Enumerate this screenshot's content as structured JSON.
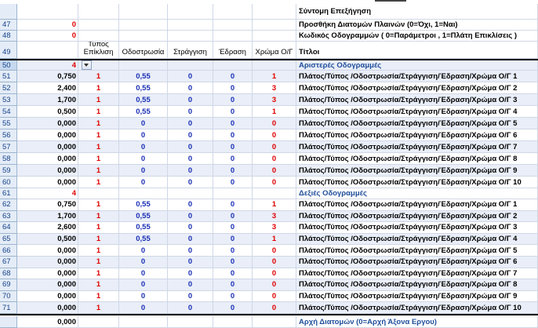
{
  "top_rows": [
    {
      "num": "",
      "b": "",
      "h": "Σύντομη Επεξήγηση"
    },
    {
      "num": "47",
      "b": "0",
      "h": "Προσθήκη Διατομών Πλαινών (0=Όχι, 1=Ναι)"
    },
    {
      "num": "48",
      "b": "0",
      "h": "Κωδικός Οδογραμμών ( 0=Παράμετροι , 1=Πλάτη Επικλίσεις )"
    }
  ],
  "header_row": {
    "num": "49",
    "c": "Τύπος Επίκλιση",
    "d": "Οδοστρωσία",
    "e": "Στράγγιση",
    "f": "Έδραση",
    "g": "Χρώμα Ο/Γ",
    "h": "Τίτλοι"
  },
  "left_group": {
    "num": "50",
    "count": "4",
    "title": "Αριστερές Οδογραμμές"
  },
  "left_rows": [
    {
      "num": "51",
      "b": "0,750",
      "c": "1",
      "d": "0,55",
      "e": "0",
      "f": "0",
      "g": "1",
      "h": "Πλάτος/Τύπος /Οδοστρωσία/Στράγγιση/Έδραση/Χρώμα Ο/Γ 1"
    },
    {
      "num": "52",
      "b": "2,400",
      "c": "1",
      "d": "0,55",
      "e": "0",
      "f": "0",
      "g": "3",
      "h": "Πλάτος/Τύπος /Οδοστρωσία/Στράγγιση/Έδραση/Χρώμα Ο/Γ 2"
    },
    {
      "num": "53",
      "b": "1,700",
      "c": "1",
      "d": "0,55",
      "e": "0",
      "f": "0",
      "g": "3",
      "h": "Πλάτος/Τύπος /Οδοστρωσία/Στράγγιση/Έδραση/Χρώμα Ο/Γ 3"
    },
    {
      "num": "54",
      "b": "0,500",
      "c": "1",
      "d": "0,55",
      "e": "0",
      "f": "0",
      "g": "1",
      "h": "Πλάτος/Τύπος /Οδοστρωσία/Στράγγιση/Έδραση/Χρώμα Ο/Γ 4"
    },
    {
      "num": "55",
      "b": "0,000",
      "c": "1",
      "d": "0",
      "e": "0",
      "f": "0",
      "g": "0",
      "h": "Πλάτος/Τύπος /Οδοστρωσία/Στράγγιση/Έδραση/Χρώμα Ο/Γ 5"
    },
    {
      "num": "56",
      "b": "0,000",
      "c": "1",
      "d": "0",
      "e": "0",
      "f": "0",
      "g": "0",
      "h": "Πλάτος/Τύπος /Οδοστρωσία/Στράγγιση/Έδραση/Χρώμα Ο/Γ 6"
    },
    {
      "num": "57",
      "b": "0,000",
      "c": "1",
      "d": "0",
      "e": "0",
      "f": "0",
      "g": "0",
      "h": "Πλάτος/Τύπος /Οδοστρωσία/Στράγγιση/Έδραση/Χρώμα Ο/Γ 7"
    },
    {
      "num": "58",
      "b": "0,000",
      "c": "1",
      "d": "0",
      "e": "0",
      "f": "0",
      "g": "0",
      "h": "Πλάτος/Τύπος /Οδοστρωσία/Στράγγιση/Έδραση/Χρώμα Ο/Γ 8"
    },
    {
      "num": "59",
      "b": "0,000",
      "c": "1",
      "d": "0",
      "e": "0",
      "f": "0",
      "g": "0",
      "h": "Πλάτος/Τύπος /Οδοστρωσία/Στράγγιση/Έδραση/Χρώμα Ο/Γ 9"
    },
    {
      "num": "60",
      "b": "0,000",
      "c": "1",
      "d": "0",
      "e": "0",
      "f": "0",
      "g": "0",
      "h": "Πλάτος/Τύπος /Οδοστρωσία/Στράγγιση/Έδραση/Χρώμα Ο/Γ 10"
    }
  ],
  "right_group": {
    "num": "61",
    "count": "4",
    "title": "Δεξιές Οδογραμμές"
  },
  "right_rows": [
    {
      "num": "62",
      "b": "0,750",
      "c": "1",
      "d": "0,55",
      "e": "0",
      "f": "0",
      "g": "1",
      "h": "Πλάτος/Τύπος /Οδοστρωσία/Στράγγιση/Έδραση/Χρώμα Ο/Γ 1"
    },
    {
      "num": "63",
      "b": "1,700",
      "c": "1",
      "d": "0,55",
      "e": "0",
      "f": "0",
      "g": "3",
      "h": "Πλάτος/Τύπος /Οδοστρωσία/Στράγγιση/Έδραση/Χρώμα Ο/Γ 2"
    },
    {
      "num": "64",
      "b": "2,600",
      "c": "1",
      "d": "0,55",
      "e": "0",
      "f": "0",
      "g": "3",
      "h": "Πλάτος/Τύπος /Οδοστρωσία/Στράγγιση/Έδραση/Χρώμα Ο/Γ 3"
    },
    {
      "num": "65",
      "b": "0,500",
      "c": "1",
      "d": "0,55",
      "e": "0",
      "f": "0",
      "g": "1",
      "h": "Πλάτος/Τύπος /Οδοστρωσία/Στράγγιση/Έδραση/Χρώμα Ο/Γ 4"
    },
    {
      "num": "66",
      "b": "0,000",
      "c": "1",
      "d": "0",
      "e": "0",
      "f": "0",
      "g": "0",
      "h": "Πλάτος/Τύπος /Οδοστρωσία/Στράγγιση/Έδραση/Χρώμα Ο/Γ 5"
    },
    {
      "num": "67",
      "b": "0,000",
      "c": "1",
      "d": "0",
      "e": "0",
      "f": "0",
      "g": "0",
      "h": "Πλάτος/Τύπος /Οδοστρωσία/Στράγγιση/Έδραση/Χρώμα Ο/Γ 6"
    },
    {
      "num": "68",
      "b": "0,000",
      "c": "1",
      "d": "0",
      "e": "0",
      "f": "0",
      "g": "0",
      "h": "Πλάτος/Τύπος /Οδοστρωσία/Στράγγιση/Έδραση/Χρώμα Ο/Γ 7"
    },
    {
      "num": "69",
      "b": "0,000",
      "c": "1",
      "d": "0",
      "e": "0",
      "f": "0",
      "g": "0",
      "h": "Πλάτος/Τύπος /Οδοστρωσία/Στράγγιση/Έδραση/Χρώμα Ο/Γ 8"
    },
    {
      "num": "70",
      "b": "0,000",
      "c": "1",
      "d": "0",
      "e": "0",
      "f": "0",
      "g": "0",
      "h": "Πλάτος/Τύπος /Οδοστρωσία/Στράγγιση/Έδραση/Χρώμα Ο/Γ 9"
    },
    {
      "num": "71",
      "b": "0,000",
      "c": "1",
      "d": "0",
      "e": "0",
      "f": "0",
      "g": "0",
      "h": "Πλάτος/Τύπος /Οδοστρωσία/Στράγγιση/Έδραση/Χρώμα Ο/Γ 10"
    }
  ],
  "bottom_row": {
    "num": "",
    "b": "0,000",
    "h": "Αρχή Διατομών (0=Αρχή Άξονα Εργου)"
  },
  "colors": {
    "red_value": "#e00000",
    "blue_value": "#1a2fb5",
    "row_header_bg": "#e4ecf7",
    "group_title": "#1f4e9a",
    "shade": "#e9eef8"
  }
}
